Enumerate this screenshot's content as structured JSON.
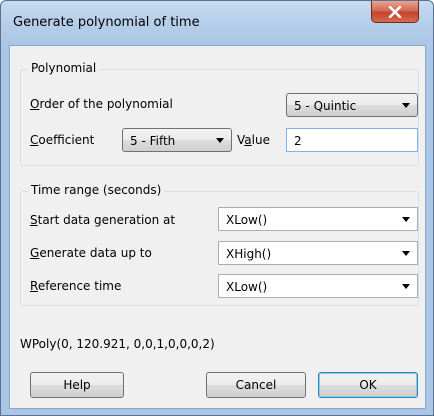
{
  "window": {
    "title": "Generate polynomial of time"
  },
  "polynomial": {
    "group_label": "Polynomial",
    "order_label": "Order of the polynomial",
    "order_value": "5 - Quintic",
    "coefficient_label": "Coefficient",
    "coefficient_value": "5 - Fifth",
    "value_label": "Value",
    "value_value": "2"
  },
  "time_range": {
    "group_label": "Time range (seconds)",
    "start_label": "Start data generation at",
    "start_value": "XLow()",
    "end_label": "Generate data up to",
    "end_value": "XHigh()",
    "reference_label": "Reference time",
    "reference_value": "XLow()"
  },
  "expression": "WPoly(0, 120.921, 0,0,1,0,0,0,2)",
  "buttons": {
    "help": "Help",
    "cancel": "Cancel",
    "ok": "OK"
  },
  "icons": {
    "close": "close-x-icon",
    "dropdown": "chevron-down-icon"
  }
}
